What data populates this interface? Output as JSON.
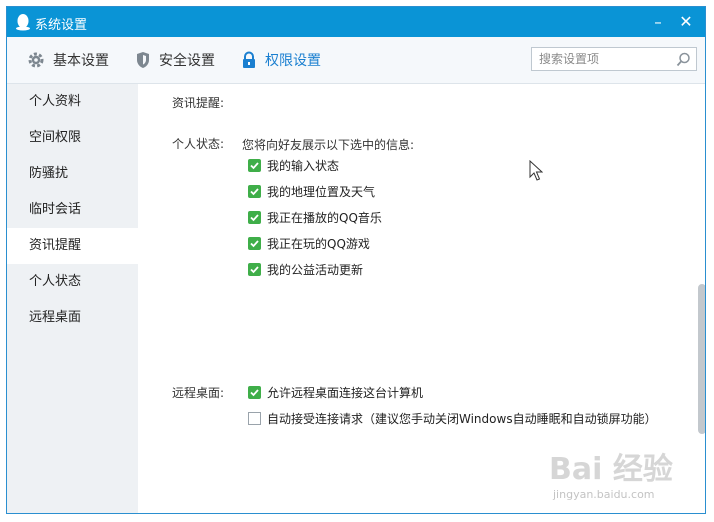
{
  "window": {
    "title": "系统设置",
    "minimize_glyph": "–",
    "close_glyph": "✕"
  },
  "tabs": [
    {
      "label": "基本设置",
      "icon": "gear-icon"
    },
    {
      "label": "安全设置",
      "icon": "shield-icon"
    },
    {
      "label": "权限设置",
      "icon": "lock-icon",
      "active": true
    }
  ],
  "search": {
    "placeholder": "搜索设置项"
  },
  "sidebar": {
    "items": [
      {
        "label": "个人资料"
      },
      {
        "label": "空间权限"
      },
      {
        "label": "防骚扰"
      },
      {
        "label": "临时会话"
      },
      {
        "label": "资讯提醒",
        "active": true
      },
      {
        "label": "个人状态"
      },
      {
        "label": "远程桌面"
      }
    ]
  },
  "content": {
    "news_label": "资讯提醒:",
    "status_label": "个人状态:",
    "status_desc": "您将向好友展示以下选中的信息:",
    "status_options": [
      {
        "label": "我的输入状态",
        "checked": true
      },
      {
        "label": "我的地理位置及天气",
        "checked": true
      },
      {
        "label": "我正在播放的QQ音乐",
        "checked": true
      },
      {
        "label": "我正在玩的QQ游戏",
        "checked": true
      },
      {
        "label": "我的公益活动更新",
        "checked": true
      }
    ],
    "remote_label": "远程桌面:",
    "remote_options": [
      {
        "label": "允许远程桌面连接这台计算机",
        "checked": true
      },
      {
        "label": "自动接受连接请求（建议您手动关闭Windows自动睡眠和自动锁屏功能）",
        "checked": false
      }
    ]
  },
  "watermark": {
    "text": "Bai 经验",
    "sub": "jingyan.baidu.com"
  },
  "colors": {
    "titlebar": "#0a94d6",
    "active_tab": "#1a7fd0",
    "check": "#3fae49"
  }
}
